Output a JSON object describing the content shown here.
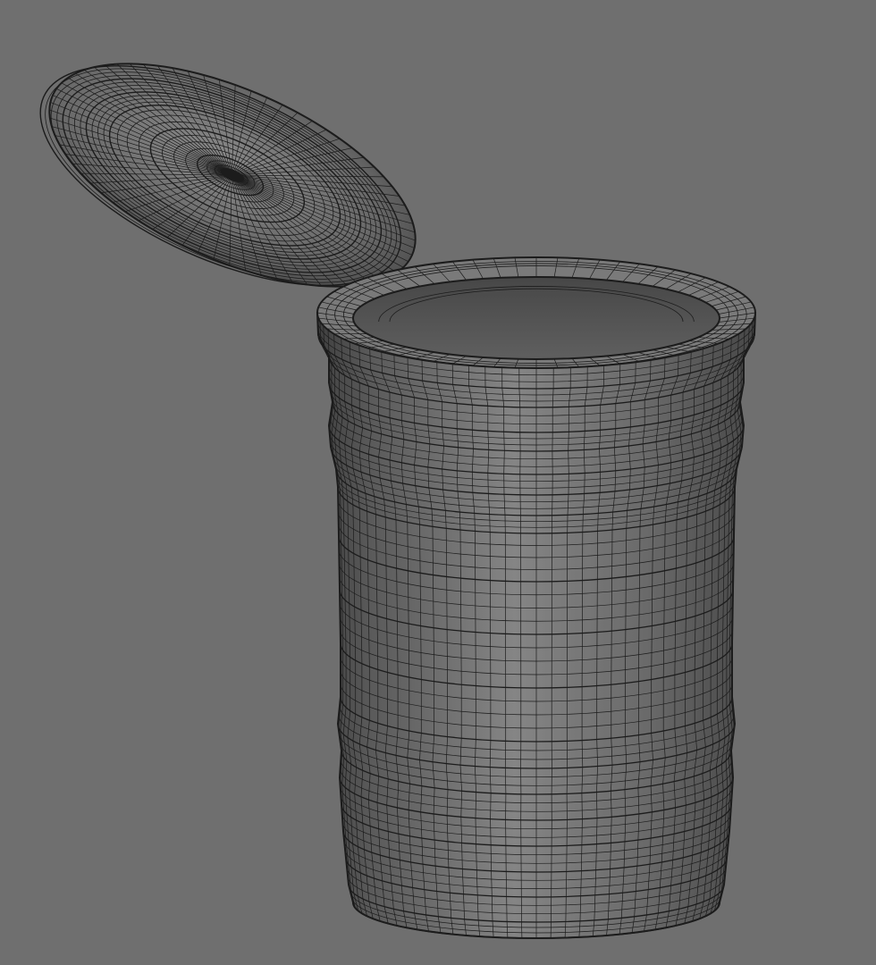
{
  "viewport": {
    "background_color": "#6f6f6f",
    "wire_color": "#1c1c1c",
    "mesh_shade_light": "#8a8a8a",
    "mesh_shade_dark": "#4e4e4e"
  },
  "objects": [
    {
      "name": "lid-mesh",
      "kind": "wireframe-disc-lid"
    },
    {
      "name": "canister-mesh",
      "kind": "wireframe-cylinder-container"
    }
  ]
}
